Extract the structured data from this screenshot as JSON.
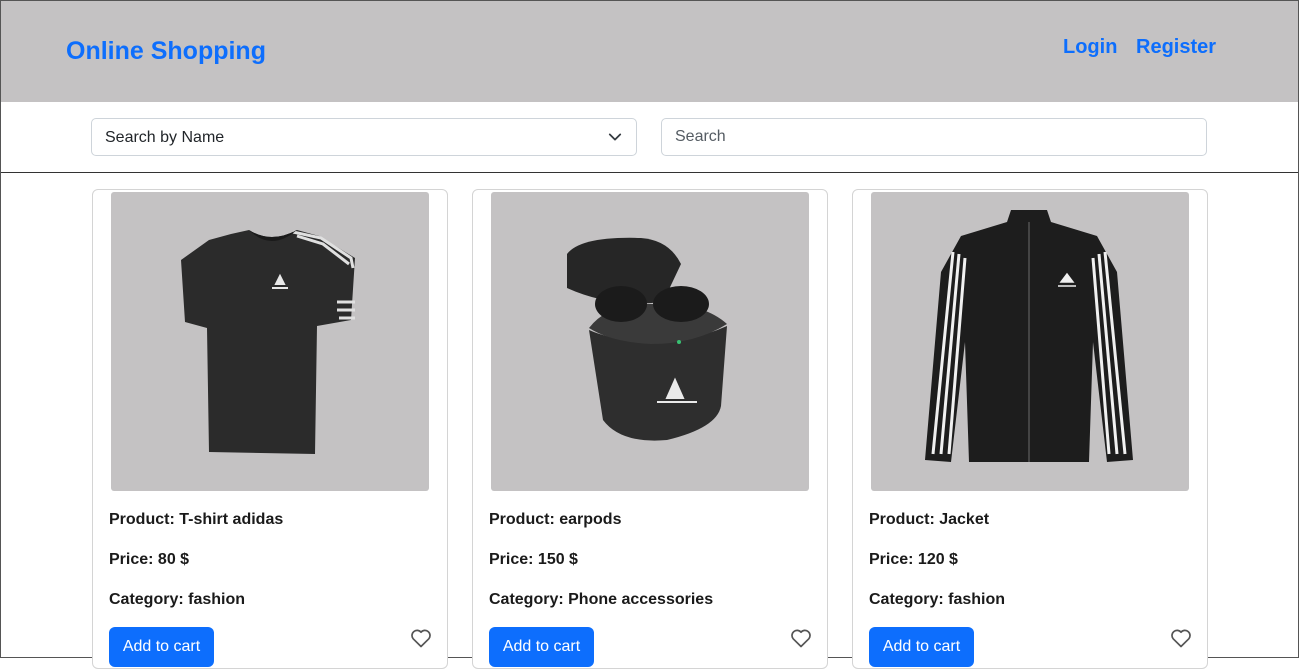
{
  "header": {
    "brand": "Online Shopping",
    "login": "Login",
    "register": "Register",
    "accent_color": "#0d6efd",
    "background_color": "#c4c2c3"
  },
  "search": {
    "mode_selected": "Search by Name",
    "placeholder": "Search",
    "value": ""
  },
  "products": [
    {
      "product_text": "Product: T-shirt adidas",
      "price_text": "Price: 80 $",
      "category_text": "Category: fashion",
      "button_label": "Add to cart",
      "image_icon": "tshirt-image",
      "favorite_icon": "heart-icon"
    },
    {
      "product_text": "Product: earpods",
      "price_text": "Price: 150 $",
      "category_text": "Category: Phone accessories",
      "button_label": "Add to cart",
      "image_icon": "earpods-image",
      "favorite_icon": "heart-icon"
    },
    {
      "product_text": "Product: Jacket",
      "price_text": "Price: 120 $",
      "category_text": "Category: fashion",
      "button_label": "Add to cart",
      "image_icon": "jacket-image",
      "favorite_icon": "heart-icon"
    }
  ]
}
